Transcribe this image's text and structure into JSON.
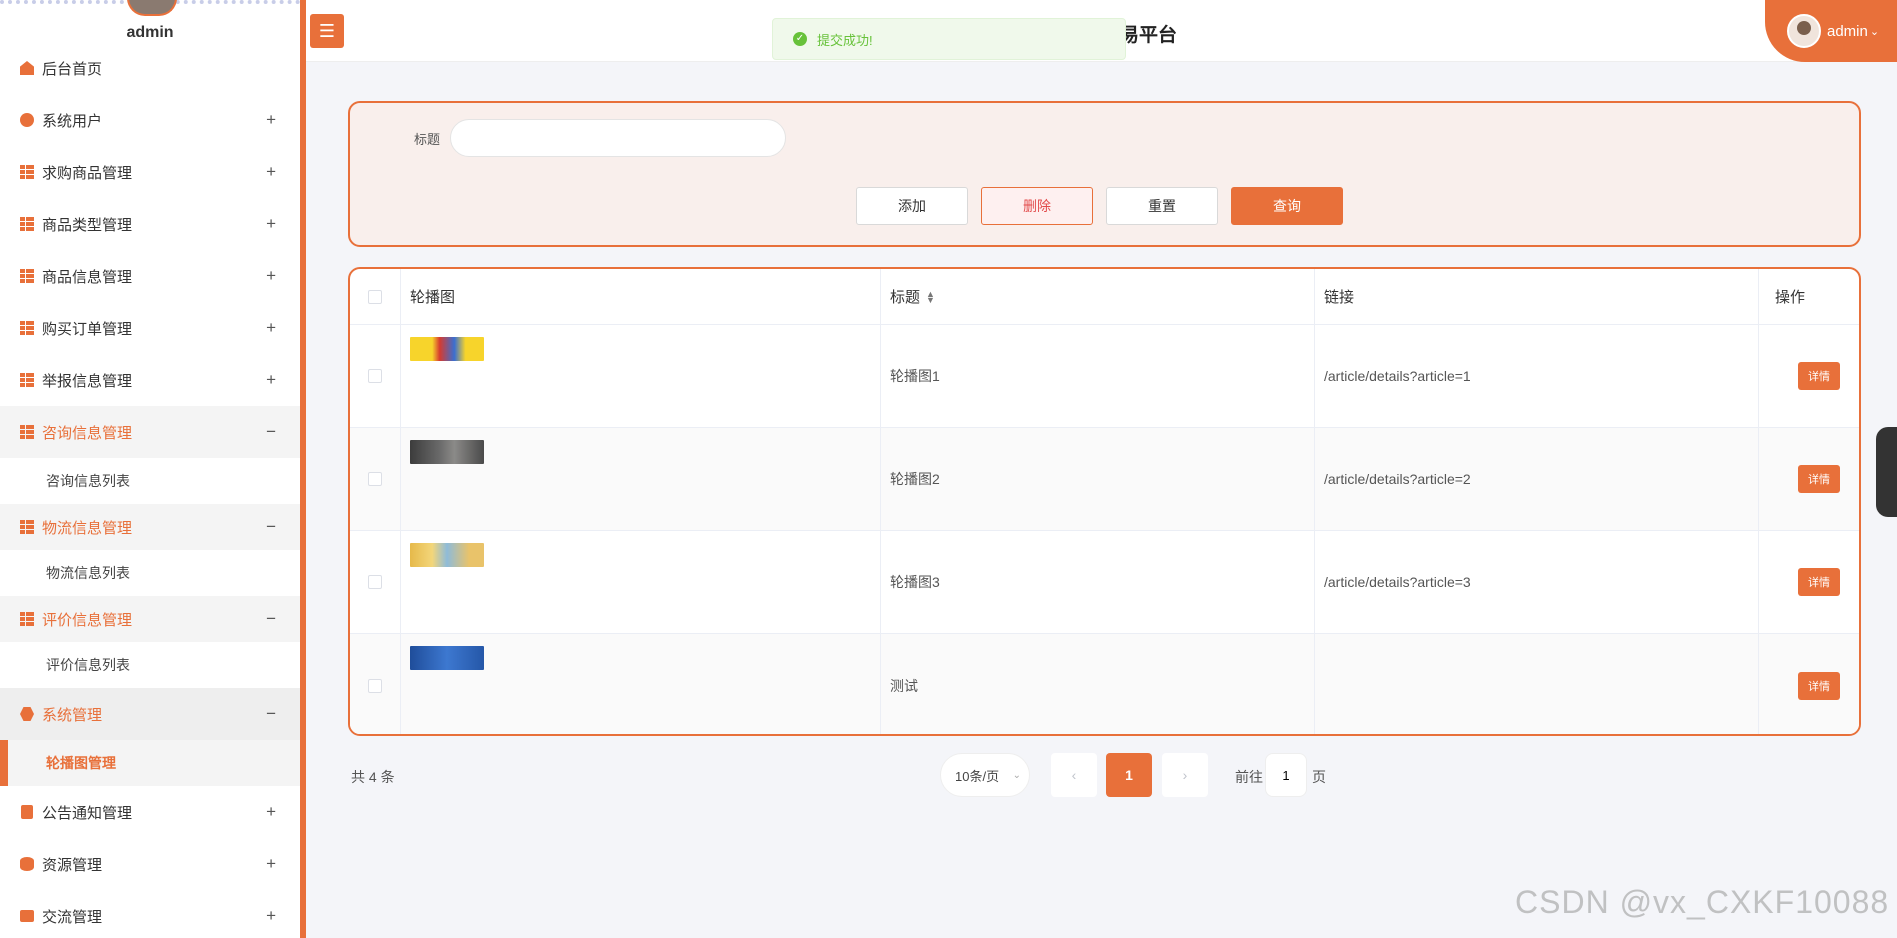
{
  "sidebar": {
    "username": "admin",
    "items": [
      {
        "label": "后台首页",
        "icon": "home-icon",
        "toggle": ""
      },
      {
        "label": "系统用户",
        "icon": "user-circle-icon",
        "toggle": "+"
      },
      {
        "label": "求购商品管理",
        "icon": "grid-icon",
        "toggle": "+"
      },
      {
        "label": "商品类型管理",
        "icon": "grid-icon",
        "toggle": "+"
      },
      {
        "label": "商品信息管理",
        "icon": "grid-icon",
        "toggle": "+"
      },
      {
        "label": "购买订单管理",
        "icon": "grid-icon",
        "toggle": "+"
      },
      {
        "label": "举报信息管理",
        "icon": "grid-icon",
        "toggle": "+"
      },
      {
        "label": "咨询信息管理",
        "icon": "grid-icon",
        "toggle": "−",
        "sub": "咨询信息列表"
      },
      {
        "label": "物流信息管理",
        "icon": "grid-icon",
        "toggle": "−",
        "sub": "物流信息列表"
      },
      {
        "label": "评价信息管理",
        "icon": "grid-icon",
        "toggle": "−",
        "sub": "评价信息列表"
      },
      {
        "label": "系统管理",
        "icon": "settings-icon",
        "toggle": "−",
        "sub": "轮播图管理"
      },
      {
        "label": "公告通知管理",
        "icon": "document-icon",
        "toggle": "+"
      },
      {
        "label": "资源管理",
        "icon": "database-icon",
        "toggle": "+"
      },
      {
        "label": "交流管理",
        "icon": "chat-icon",
        "toggle": "+"
      }
    ]
  },
  "header": {
    "title": "易平台",
    "user": "admin"
  },
  "toast": {
    "message": "提交成功!"
  },
  "search": {
    "label": "标题",
    "value": "",
    "placeholder": "",
    "buttons": {
      "add": "添加",
      "delete": "删除",
      "reset": "重置",
      "query": "查询"
    }
  },
  "table": {
    "columns": {
      "image": "轮播图",
      "title": "标题",
      "link": "链接",
      "action": "操作"
    },
    "rows": [
      {
        "title": "轮播图1",
        "link": "/article/details?article=1",
        "action": "详情"
      },
      {
        "title": "轮播图2",
        "link": "/article/details?article=2",
        "action": "详情"
      },
      {
        "title": "轮播图3",
        "link": "/article/details?article=3",
        "action": "详情"
      },
      {
        "title": "测试",
        "link": "",
        "action": "详情"
      }
    ]
  },
  "pagination": {
    "total": "共 4 条",
    "page_size": "10条/页",
    "prev": "‹",
    "current": "1",
    "next": "›",
    "goto_label": "前往",
    "goto_value": "1",
    "goto_suffix": "页"
  },
  "watermark": "CSDN @vx_CXKF10088",
  "colors": {
    "accent": "#e8703a",
    "success": "#67c23a"
  }
}
